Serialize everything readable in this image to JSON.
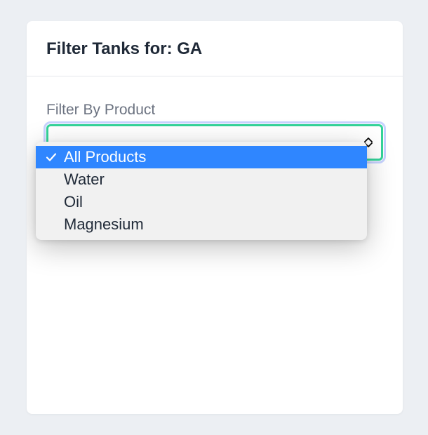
{
  "header": {
    "title": "Filter Tanks for: GA"
  },
  "filter": {
    "label": "Filter By Product",
    "selected_index": 0,
    "options": [
      {
        "label": "All Products"
      },
      {
        "label": "Water"
      },
      {
        "label": "Oil"
      },
      {
        "label": "Magnesium"
      }
    ]
  }
}
